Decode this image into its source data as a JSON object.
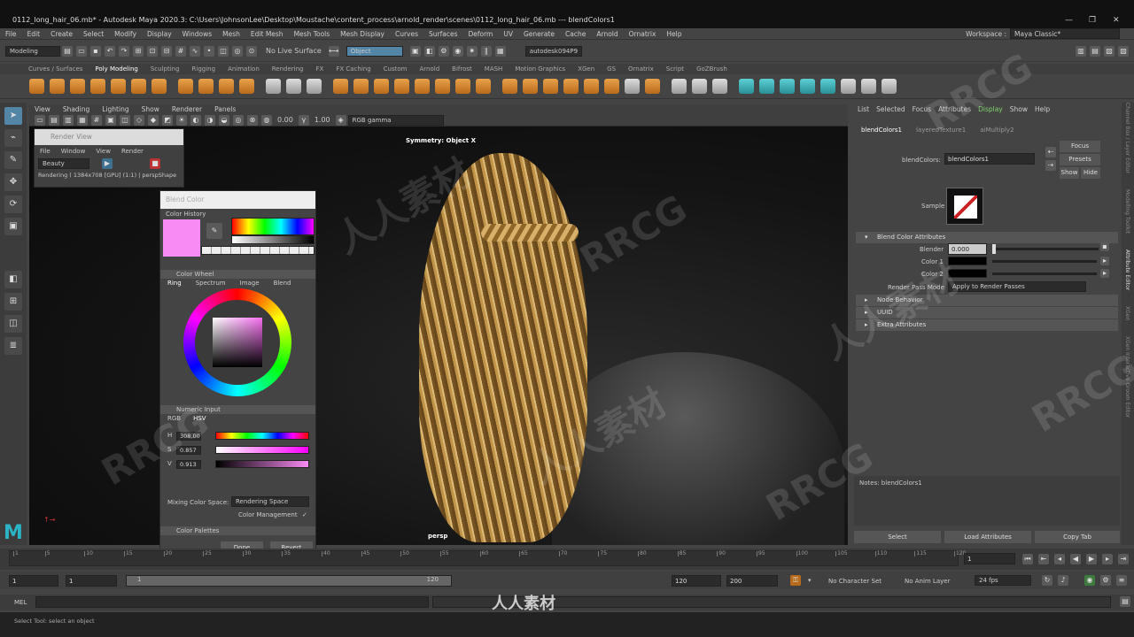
{
  "window": {
    "title": "0112_long_hair_06.mb* - Autodesk Maya 2020.3: C:\\Users\\JohnsonLee\\Desktop\\Moustache\\content_process\\arnold_render\\scenes\\0112_long_hair_06.mb  ---  blendColors1",
    "buttons": [
      "—",
      "❐",
      "✕"
    ]
  },
  "menubar": [
    "File",
    "Edit",
    "Create",
    "Select",
    "Modify",
    "Display",
    "Windows",
    "Mesh",
    "Edit Mesh",
    "Mesh Tools",
    "Mesh Display",
    "Curves",
    "Surfaces",
    "Deform",
    "UV",
    "Generate",
    "Cache",
    "Arnold",
    "Ornatrix",
    "Help"
  ],
  "workspace": {
    "label": "Workspace :",
    "value": "Maya Classic*"
  },
  "statusline": {
    "mode": "Modeling",
    "live_surface": "No Live Surface",
    "object": "Object",
    "user": "autodesk094P9"
  },
  "shelf_tabs": [
    "Curves / Surfaces",
    "Poly Modeling",
    "Sculpting",
    "Rigging",
    "Animation",
    "Rendering",
    "FX",
    "FX Caching",
    "Custom",
    "Arnold",
    "Bifrost",
    "MASH",
    "Motion Graphics",
    "XGen",
    "GS",
    "Ornatrix",
    "Script",
    "GoZBrush"
  ],
  "shelf_active": "Poly Modeling",
  "viewport": {
    "menu": [
      "View",
      "Shading",
      "Lighting",
      "Show",
      "Renderer",
      "Panels"
    ],
    "exposure": "0.00",
    "gamma": "1.00",
    "colorspace": "RGB gamma",
    "symmetry": "Symmetry: Object X",
    "camera": "persp"
  },
  "render_view": {
    "title": "Render View",
    "menu": [
      "File",
      "Window",
      "View",
      "Render"
    ],
    "layer": "Beauty",
    "status": "Rendering ( 1384x708 [GPU] (1:1) | perspShape"
  },
  "color_picker": {
    "title": "Blend Color",
    "history_label": "Color History",
    "wheel_section": "Color Wheel",
    "wheel_tabs": [
      "Ring",
      "Spectrum",
      "Image",
      "Blend"
    ],
    "numeric_section": "Numeric Input",
    "modes": [
      "RGB",
      "HSV"
    ],
    "h_label": "H",
    "h": "308.00",
    "s_label": "S",
    "s": "0.857",
    "v_label": "V",
    "v": "0.913",
    "mixing_label": "Mixing Color Space:",
    "mixing_value": "Rendering Space",
    "management_label": "Color Management",
    "management_check": "✓",
    "palettes": "Color Palettes",
    "done": "Done",
    "revert": "Revert",
    "swatch": "#f98bf4"
  },
  "attribute_editor": {
    "menu": [
      "List",
      "Selected",
      "Focus",
      "Attributes",
      "Display",
      "Show",
      "Help"
    ],
    "tabs": [
      "blendColors1",
      "layeredTexture1",
      "aiMultiply2"
    ],
    "node_label": "blendColors:",
    "node_name": "blendColors1",
    "focus": "Focus",
    "presets": "Presets",
    "show": "Show",
    "hide": "Hide",
    "sample": "Sample",
    "section_blend": "Blend Color Attributes",
    "blender_label": "Blender",
    "blender_value": "0.000",
    "color1_label": "Color 1",
    "color2_label": "Color 2",
    "render_pass_label": "Render Pass Mode",
    "render_pass_value": "Apply to Render Passes",
    "sections": [
      "Node Behavior",
      "UUID",
      "Extra Attributes"
    ],
    "notes": "Notes:  blendColors1",
    "select": "Select",
    "load": "Load Attributes",
    "copy": "Copy Tab"
  },
  "right_side_tabs": [
    "Channel Box / Layer Editor",
    "Modelling Toolkit",
    "Attribute Editor",
    "XGen",
    "XGen Interactive Groom Editor"
  ],
  "timeslider": {
    "ticks": [
      "1",
      "5",
      "10",
      "15",
      "20",
      "25",
      "30",
      "35",
      "40",
      "45",
      "50",
      "55",
      "60",
      "65",
      "70",
      "75",
      "80",
      "85",
      "90",
      "95",
      "100",
      "105",
      "110",
      "115",
      "120"
    ],
    "current": "1"
  },
  "range": {
    "start": "1",
    "inner_start": "1",
    "inner_bar": "1",
    "inner_end": "120",
    "end_a": "120",
    "end_b": "200",
    "character_set": "No Character Set",
    "anim_layer": "No Anim Layer",
    "fps": "24 fps"
  },
  "cmdline": {
    "label": "MEL"
  },
  "helpline": "Select Tool: select an object",
  "watermarks": [
    "人人素材",
    "RRCG"
  ],
  "footer_logo": "人人素材"
}
